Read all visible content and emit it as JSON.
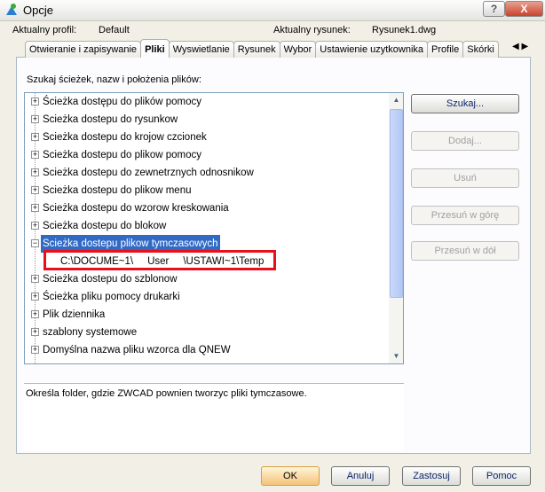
{
  "window": {
    "title": "Opcje",
    "help": "?",
    "close": "X"
  },
  "header": {
    "profile_label": "Aktualny profil:",
    "profile_value": "Default",
    "drawing_label": "Aktualny rysunek:",
    "drawing_value": "Rysunek1.dwg"
  },
  "tabs": [
    "Otwieranie i zapisywanie",
    "Pliki",
    "Wyswietlanie",
    "Rysunek",
    "Wybor",
    "Ustawienie uzytkownika",
    "Profile",
    "Skórki"
  ],
  "active_tab": "Pliki",
  "search_label": "Szukaj ścieżek, nazw i położenia plików:",
  "tree": [
    {
      "label": "Ścieżka dostępu do plików pomocy",
      "expander": "+"
    },
    {
      "label": "Scieżka dostepu do rysunkow",
      "expander": "+"
    },
    {
      "label": "Scieżka dostepu do krojow czcionek",
      "expander": "+"
    },
    {
      "label": "Scieżka dostepu do plikow pomocy",
      "expander": "+"
    },
    {
      "label": "Scieżka dostepu do zewnetrznych odnosnikow",
      "expander": "+"
    },
    {
      "label": "Scieżka dostepu do plikow menu",
      "expander": "+"
    },
    {
      "label": "Scieżka dostepu do wzorow kreskowania",
      "expander": "+"
    },
    {
      "label": "Scieżka dostepu do blokow",
      "expander": "+"
    },
    {
      "label": "Scieżka dostepu plikow tymczasowych",
      "expander": "−",
      "selected": true
    },
    {
      "label": "C:\\DOCUME~1\\     User     \\USTAWI~1\\Temp",
      "child": true
    },
    {
      "label": "Scieżka dostepu do szblonow",
      "expander": "+"
    },
    {
      "label": "Ścieżka pliku pomocy drukarki",
      "expander": "+"
    },
    {
      "label": "Plik dziennika",
      "expander": "+"
    },
    {
      "label": "szablony systemowe",
      "expander": "+"
    },
    {
      "label": "Domyślna nazwa pliku wzorca dla QNEW",
      "expander": "+"
    }
  ],
  "side_buttons": [
    {
      "label": "Szukaj...",
      "enabled": true
    },
    {
      "label": "Dodaj...",
      "enabled": false
    },
    {
      "label": "Usuń",
      "enabled": false
    },
    {
      "label": "Przesuń w górę",
      "enabled": false
    },
    {
      "label": "Przesuń w dół",
      "enabled": false
    }
  ],
  "description": "Określa folder, gdzie ZWCAD pownien tworzyc pliki tymczasowe.",
  "footer": {
    "ok": "OK",
    "cancel": "Anuluj",
    "apply": "Zastosuj",
    "help": "Pomoc"
  },
  "colors": {
    "selection": "#316ac5",
    "highlight_box": "#e8101a"
  }
}
